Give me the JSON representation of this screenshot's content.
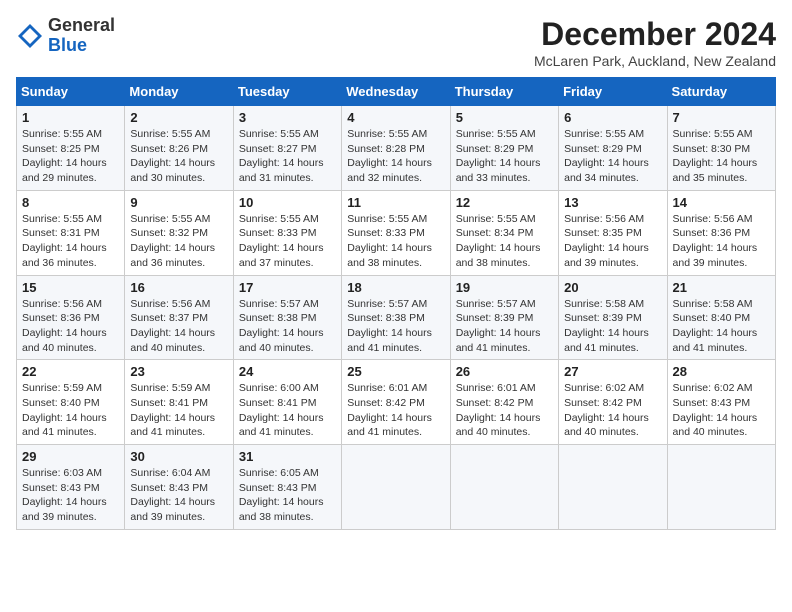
{
  "header": {
    "logo_general": "General",
    "logo_blue": "Blue",
    "month_title": "December 2024",
    "location": "McLaren Park, Auckland, New Zealand"
  },
  "weekdays": [
    "Sunday",
    "Monday",
    "Tuesday",
    "Wednesday",
    "Thursday",
    "Friday",
    "Saturday"
  ],
  "weeks": [
    [
      {
        "day": "1",
        "sunrise": "Sunrise: 5:55 AM",
        "sunset": "Sunset: 8:25 PM",
        "daylight": "Daylight: 14 hours and 29 minutes."
      },
      {
        "day": "2",
        "sunrise": "Sunrise: 5:55 AM",
        "sunset": "Sunset: 8:26 PM",
        "daylight": "Daylight: 14 hours and 30 minutes."
      },
      {
        "day": "3",
        "sunrise": "Sunrise: 5:55 AM",
        "sunset": "Sunset: 8:27 PM",
        "daylight": "Daylight: 14 hours and 31 minutes."
      },
      {
        "day": "4",
        "sunrise": "Sunrise: 5:55 AM",
        "sunset": "Sunset: 8:28 PM",
        "daylight": "Daylight: 14 hours and 32 minutes."
      },
      {
        "day": "5",
        "sunrise": "Sunrise: 5:55 AM",
        "sunset": "Sunset: 8:29 PM",
        "daylight": "Daylight: 14 hours and 33 minutes."
      },
      {
        "day": "6",
        "sunrise": "Sunrise: 5:55 AM",
        "sunset": "Sunset: 8:29 PM",
        "daylight": "Daylight: 14 hours and 34 minutes."
      },
      {
        "day": "7",
        "sunrise": "Sunrise: 5:55 AM",
        "sunset": "Sunset: 8:30 PM",
        "daylight": "Daylight: 14 hours and 35 minutes."
      }
    ],
    [
      {
        "day": "8",
        "sunrise": "Sunrise: 5:55 AM",
        "sunset": "Sunset: 8:31 PM",
        "daylight": "Daylight: 14 hours and 36 minutes."
      },
      {
        "day": "9",
        "sunrise": "Sunrise: 5:55 AM",
        "sunset": "Sunset: 8:32 PM",
        "daylight": "Daylight: 14 hours and 36 minutes."
      },
      {
        "day": "10",
        "sunrise": "Sunrise: 5:55 AM",
        "sunset": "Sunset: 8:33 PM",
        "daylight": "Daylight: 14 hours and 37 minutes."
      },
      {
        "day": "11",
        "sunrise": "Sunrise: 5:55 AM",
        "sunset": "Sunset: 8:33 PM",
        "daylight": "Daylight: 14 hours and 38 minutes."
      },
      {
        "day": "12",
        "sunrise": "Sunrise: 5:55 AM",
        "sunset": "Sunset: 8:34 PM",
        "daylight": "Daylight: 14 hours and 38 minutes."
      },
      {
        "day": "13",
        "sunrise": "Sunrise: 5:56 AM",
        "sunset": "Sunset: 8:35 PM",
        "daylight": "Daylight: 14 hours and 39 minutes."
      },
      {
        "day": "14",
        "sunrise": "Sunrise: 5:56 AM",
        "sunset": "Sunset: 8:36 PM",
        "daylight": "Daylight: 14 hours and 39 minutes."
      }
    ],
    [
      {
        "day": "15",
        "sunrise": "Sunrise: 5:56 AM",
        "sunset": "Sunset: 8:36 PM",
        "daylight": "Daylight: 14 hours and 40 minutes."
      },
      {
        "day": "16",
        "sunrise": "Sunrise: 5:56 AM",
        "sunset": "Sunset: 8:37 PM",
        "daylight": "Daylight: 14 hours and 40 minutes."
      },
      {
        "day": "17",
        "sunrise": "Sunrise: 5:57 AM",
        "sunset": "Sunset: 8:38 PM",
        "daylight": "Daylight: 14 hours and 40 minutes."
      },
      {
        "day": "18",
        "sunrise": "Sunrise: 5:57 AM",
        "sunset": "Sunset: 8:38 PM",
        "daylight": "Daylight: 14 hours and 41 minutes."
      },
      {
        "day": "19",
        "sunrise": "Sunrise: 5:57 AM",
        "sunset": "Sunset: 8:39 PM",
        "daylight": "Daylight: 14 hours and 41 minutes."
      },
      {
        "day": "20",
        "sunrise": "Sunrise: 5:58 AM",
        "sunset": "Sunset: 8:39 PM",
        "daylight": "Daylight: 14 hours and 41 minutes."
      },
      {
        "day": "21",
        "sunrise": "Sunrise: 5:58 AM",
        "sunset": "Sunset: 8:40 PM",
        "daylight": "Daylight: 14 hours and 41 minutes."
      }
    ],
    [
      {
        "day": "22",
        "sunrise": "Sunrise: 5:59 AM",
        "sunset": "Sunset: 8:40 PM",
        "daylight": "Daylight: 14 hours and 41 minutes."
      },
      {
        "day": "23",
        "sunrise": "Sunrise: 5:59 AM",
        "sunset": "Sunset: 8:41 PM",
        "daylight": "Daylight: 14 hours and 41 minutes."
      },
      {
        "day": "24",
        "sunrise": "Sunrise: 6:00 AM",
        "sunset": "Sunset: 8:41 PM",
        "daylight": "Daylight: 14 hours and 41 minutes."
      },
      {
        "day": "25",
        "sunrise": "Sunrise: 6:01 AM",
        "sunset": "Sunset: 8:42 PM",
        "daylight": "Daylight: 14 hours and 41 minutes."
      },
      {
        "day": "26",
        "sunrise": "Sunrise: 6:01 AM",
        "sunset": "Sunset: 8:42 PM",
        "daylight": "Daylight: 14 hours and 40 minutes."
      },
      {
        "day": "27",
        "sunrise": "Sunrise: 6:02 AM",
        "sunset": "Sunset: 8:42 PM",
        "daylight": "Daylight: 14 hours and 40 minutes."
      },
      {
        "day": "28",
        "sunrise": "Sunrise: 6:02 AM",
        "sunset": "Sunset: 8:43 PM",
        "daylight": "Daylight: 14 hours and 40 minutes."
      }
    ],
    [
      {
        "day": "29",
        "sunrise": "Sunrise: 6:03 AM",
        "sunset": "Sunset: 8:43 PM",
        "daylight": "Daylight: 14 hours and 39 minutes."
      },
      {
        "day": "30",
        "sunrise": "Sunrise: 6:04 AM",
        "sunset": "Sunset: 8:43 PM",
        "daylight": "Daylight: 14 hours and 39 minutes."
      },
      {
        "day": "31",
        "sunrise": "Sunrise: 6:05 AM",
        "sunset": "Sunset: 8:43 PM",
        "daylight": "Daylight: 14 hours and 38 minutes."
      },
      null,
      null,
      null,
      null
    ]
  ]
}
